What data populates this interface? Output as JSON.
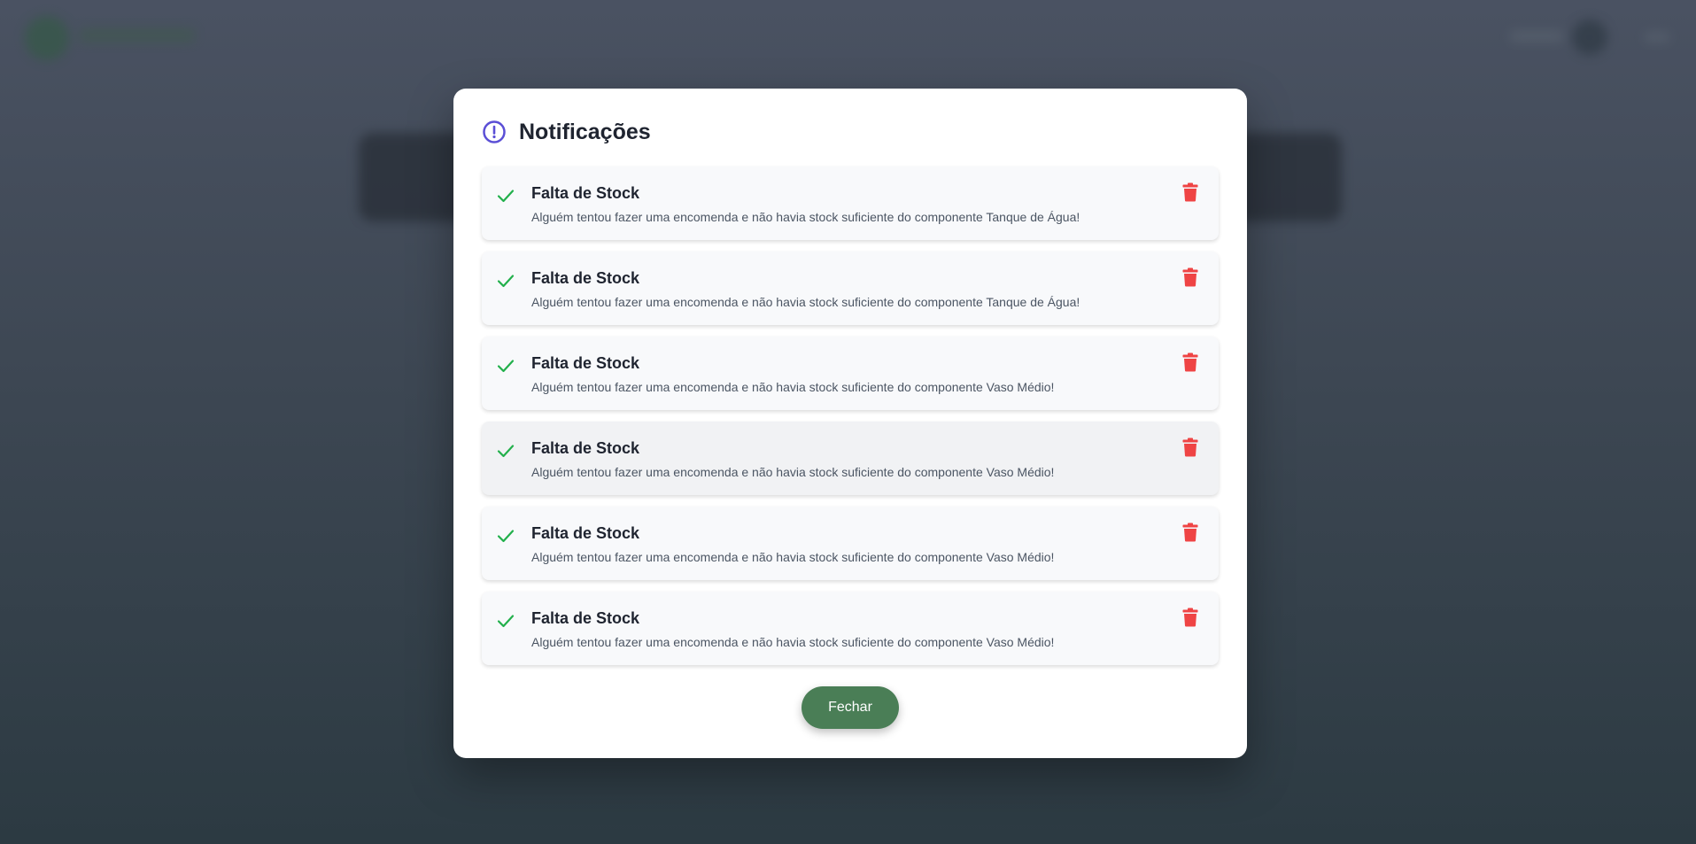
{
  "modal": {
    "title": "Notificações",
    "header_icon": "alert-circle-icon",
    "notifications": [
      {
        "title": "Falta de Stock",
        "message": "Alguém tentou fazer uma encomenda e não havia stock suficiente do componente Tanque de Água!",
        "status_icon": "check-icon",
        "action_icon": "trash-icon"
      },
      {
        "title": "Falta de Stock",
        "message": "Alguém tentou fazer uma encomenda e não havia stock suficiente do componente Tanque de Água!",
        "status_icon": "check-icon",
        "action_icon": "trash-icon"
      },
      {
        "title": "Falta de Stock",
        "message": "Alguém tentou fazer uma encomenda e não havia stock suficiente do componente Vaso Médio!",
        "status_icon": "check-icon",
        "action_icon": "trash-icon"
      },
      {
        "title": "Falta de Stock",
        "message": "Alguém tentou fazer uma encomenda e não havia stock suficiente do componente Vaso Médio!",
        "status_icon": "check-icon",
        "action_icon": "trash-icon"
      },
      {
        "title": "Falta de Stock",
        "message": "Alguém tentou fazer uma encomenda e não havia stock suficiente do componente Vaso Médio!",
        "status_icon": "check-icon",
        "action_icon": "trash-icon"
      },
      {
        "title": "Falta de Stock",
        "message": "Alguém tentou fazer uma encomenda e não havia stock suficiente do componente Vaso Médio!",
        "status_icon": "check-icon",
        "action_icon": "trash-icon"
      }
    ],
    "close_label": "Fechar"
  },
  "colors": {
    "accent_purple": "#5b4fd6",
    "check_green": "#22b04b",
    "trash_red": "#ef4444",
    "button_green": "#4a7e56",
    "overlay": "#3d4753"
  }
}
